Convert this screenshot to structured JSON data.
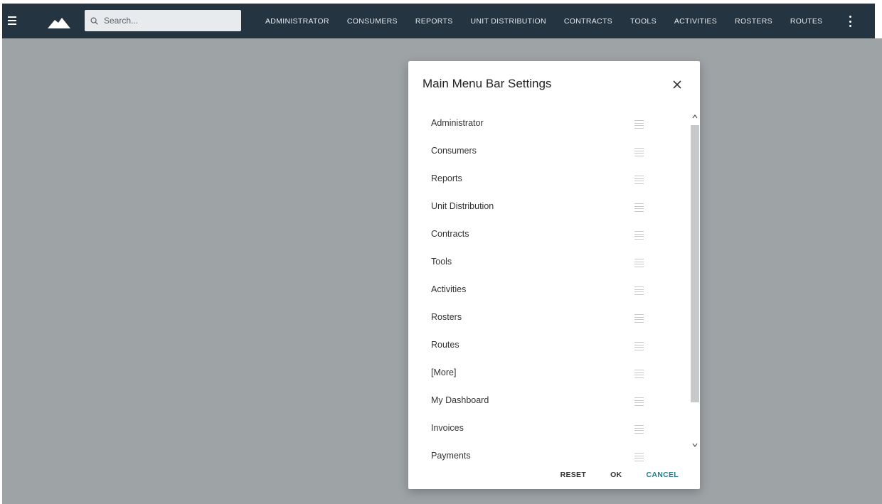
{
  "topbar": {
    "search_placeholder": "Search...",
    "icons": {
      "menu": "hamburger-icon",
      "logo": "mountain-logo",
      "search": "search-icon",
      "more": "more-vert-icon"
    },
    "nav_items": [
      "ADMINISTRATOR",
      "CONSUMERS",
      "REPORTS",
      "UNIT DISTRIBUTION",
      "CONTRACTS",
      "TOOLS",
      "ACTIVITIES",
      "ROSTERS",
      "ROUTES"
    ]
  },
  "dialog": {
    "title": "Main Menu Bar Settings",
    "items": [
      "Administrator",
      "Consumers",
      "Reports",
      "Unit Distribution",
      "Contracts",
      "Tools",
      "Activities",
      "Rosters",
      "Routes",
      "[More]",
      "My Dashboard",
      "Invoices",
      "Payments"
    ],
    "actions": {
      "reset": "RESET",
      "ok": "OK",
      "cancel": "CANCEL"
    }
  },
  "colors": {
    "topbar": "#243541",
    "overlay": "#9ea3a6",
    "accent": "#2a7a8c"
  }
}
